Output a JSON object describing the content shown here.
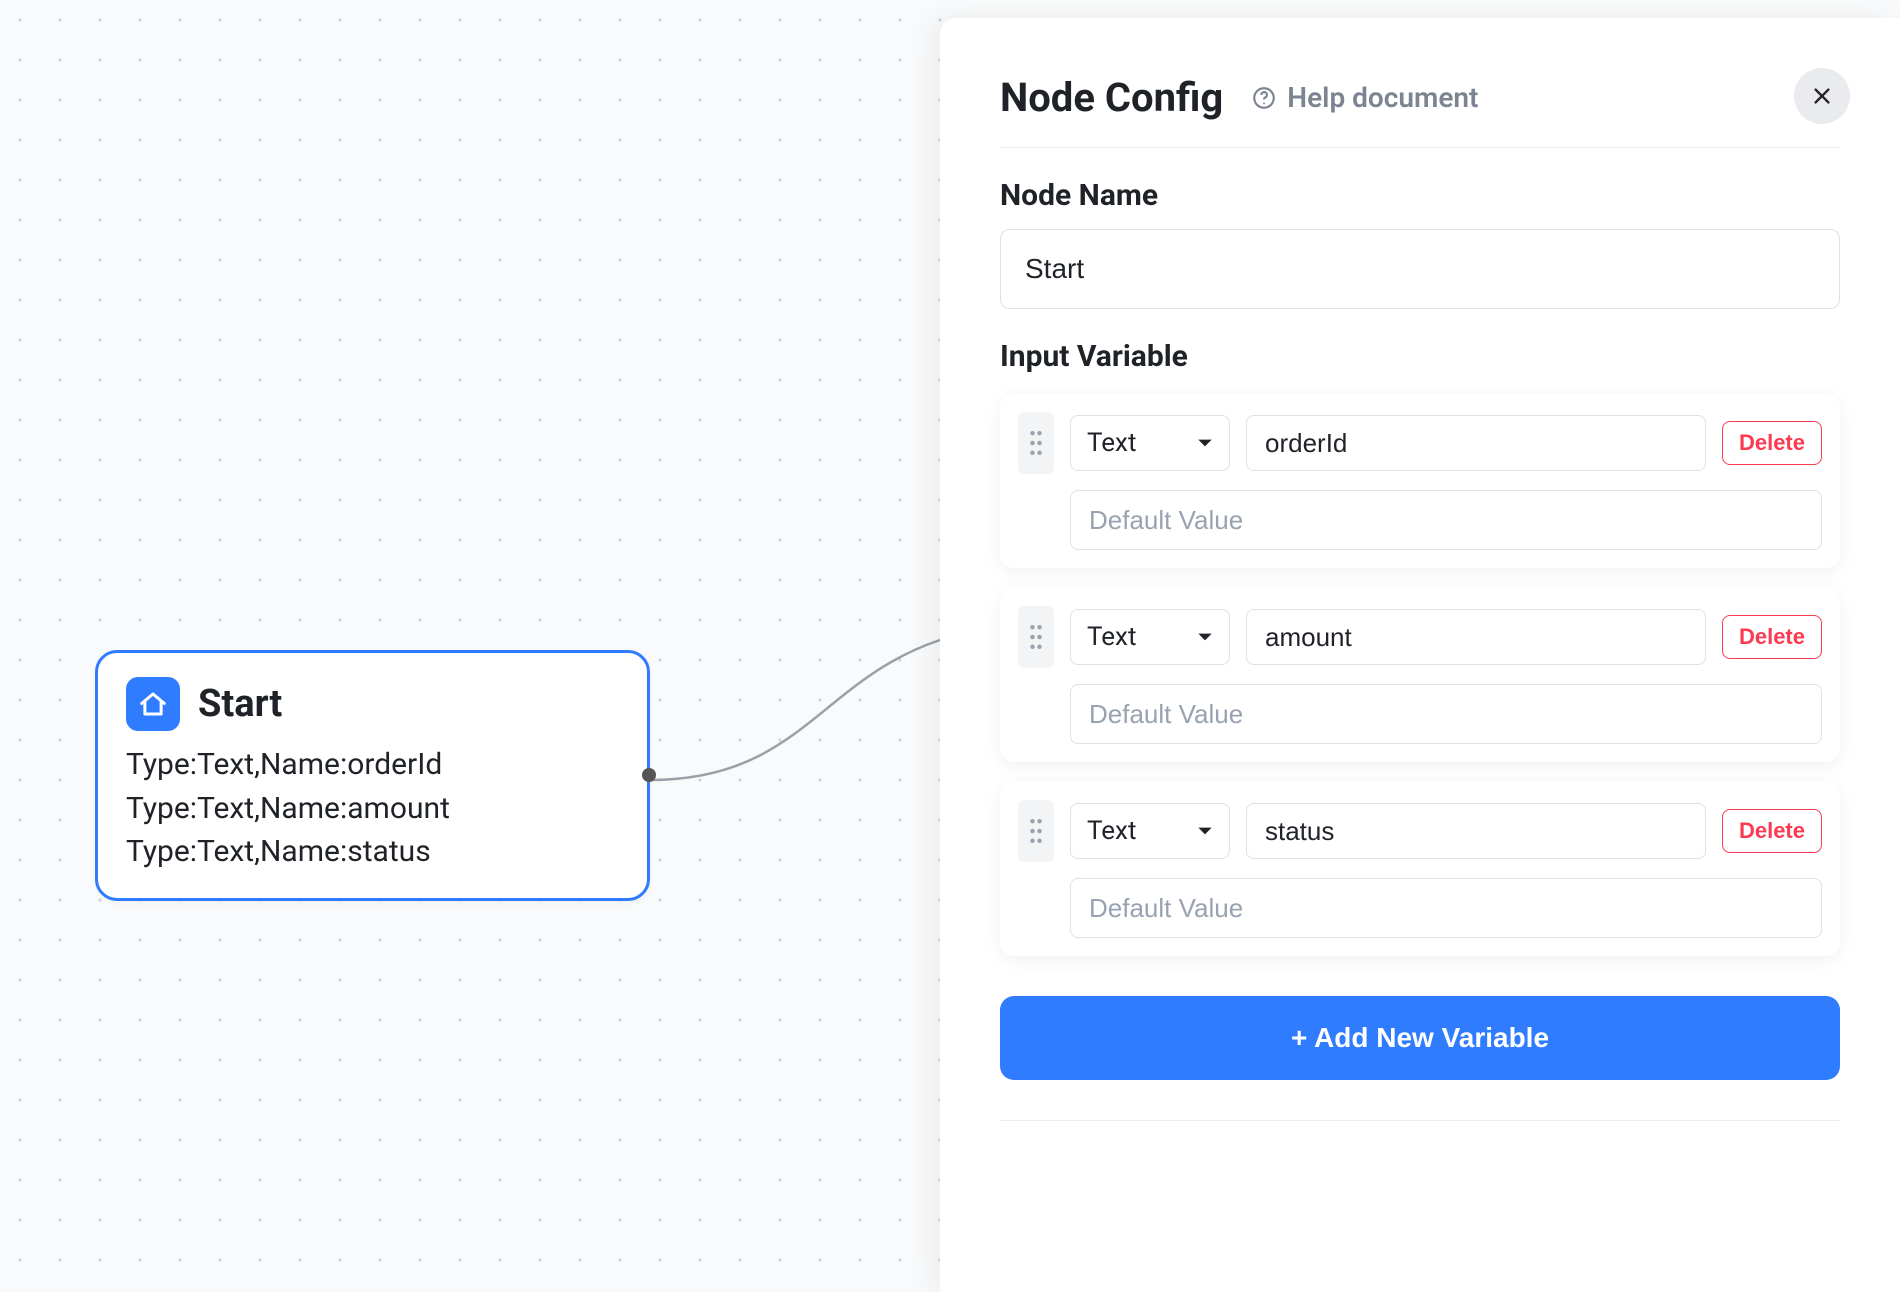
{
  "canvas": {
    "node": {
      "title": "Start",
      "lines": [
        "Type:Text,Name:orderId",
        "Type:Text,Name:amount",
        "Type:Text,Name:status"
      ]
    }
  },
  "panel": {
    "title": "Node Config",
    "help_label": "Help document",
    "node_name_label": "Node Name",
    "node_name_value": "Start",
    "input_variable_label": "Input Variable",
    "default_placeholder": "Default Value",
    "delete_label": "Delete",
    "add_label": "+ Add New Variable",
    "variables": [
      {
        "type": "Text",
        "name": "orderId",
        "default": ""
      },
      {
        "type": "Text",
        "name": "amount",
        "default": ""
      },
      {
        "type": "Text",
        "name": "status",
        "default": ""
      }
    ]
  }
}
